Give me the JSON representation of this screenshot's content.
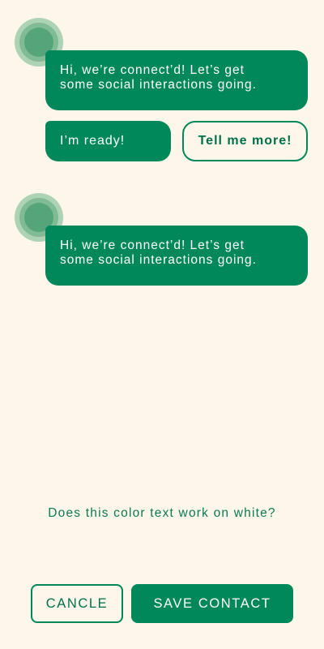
{
  "colors": {
    "background": "#fdf6ea",
    "accent": "#00875a",
    "avatar_outer": "#aed2b5",
    "avatar_core": "#56a57a"
  },
  "chat": {
    "messages": [
      {
        "lines": [
          "Hi, we’re connect’d! Let’s get",
          "some social interactions going."
        ],
        "avatar_icon": "bot-avatar-icon"
      },
      {
        "lines": [
          "Hi, we’re connect’d! Let’s get",
          "some social interactions going."
        ],
        "avatar_icon": "bot-avatar-icon"
      }
    ],
    "quick_replies": [
      {
        "label": "I’m ready!",
        "style": "filled"
      },
      {
        "label": "Tell me more!",
        "style": "outline"
      }
    ]
  },
  "prompt": {
    "question": "Does this color text work on white?"
  },
  "actions": {
    "cancel_label": "CANCLE",
    "save_label": "SAVE CONTACT"
  }
}
